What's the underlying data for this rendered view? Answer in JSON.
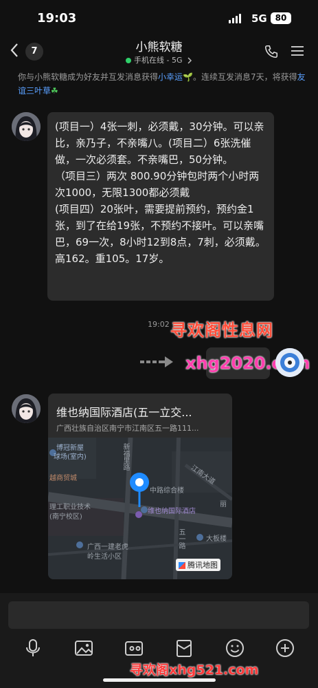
{
  "status": {
    "time": "19:03",
    "network": "5G",
    "battery": "80"
  },
  "header": {
    "unread_count": "7",
    "title": "小熊软糖",
    "status_text": "手机在线 - 5G"
  },
  "notice": {
    "part1": "你与小熊软糖成为好友并互发消息获得",
    "link1": "小幸运",
    "part2": "。连续互发消息7天，将获得",
    "link2": "友谊三叶草"
  },
  "messages": [
    {
      "text": "(项目一）4张一刺，必须戴，30分钟。可以亲比，亲乃子，不亲嘴八。(项目二）6张洗催做，一次必须套。不亲嘴巴，50分钟。\n（项目三）两次 800.90分钟包时两个小时两次1000，无限1300都必须戴\n(项目四）20张叶，需要提前预约，预约金1张，到了在给19张，不预约不接叶。可以亲嘴巴，69一次，8小时12到8点，7刺，必须戴。高162。重105。17岁。"
    }
  ],
  "sent": {
    "timestamp": "19:02"
  },
  "location": {
    "title": "维也纳国际酒店(五一立交...",
    "address": "广西壮族自治区南宁市江南区五一路111...",
    "map_labels": [
      "博冠新屋",
      "球场(室内)",
      "新福里路",
      "江南大道",
      "越商贸城",
      "中路综合楼",
      "维也纳国际酒店",
      "理工职业技术",
      "(南宁校区)",
      "五一路",
      "大板楼",
      "丽",
      "广西一建老虎",
      "岭生活小区"
    ],
    "provider": "腾讯地图"
  },
  "watermarks": {
    "top": "寻欢阁性息网",
    "middle": "xhg2020.com",
    "bottom": "寻欢阁xhg521.com"
  }
}
